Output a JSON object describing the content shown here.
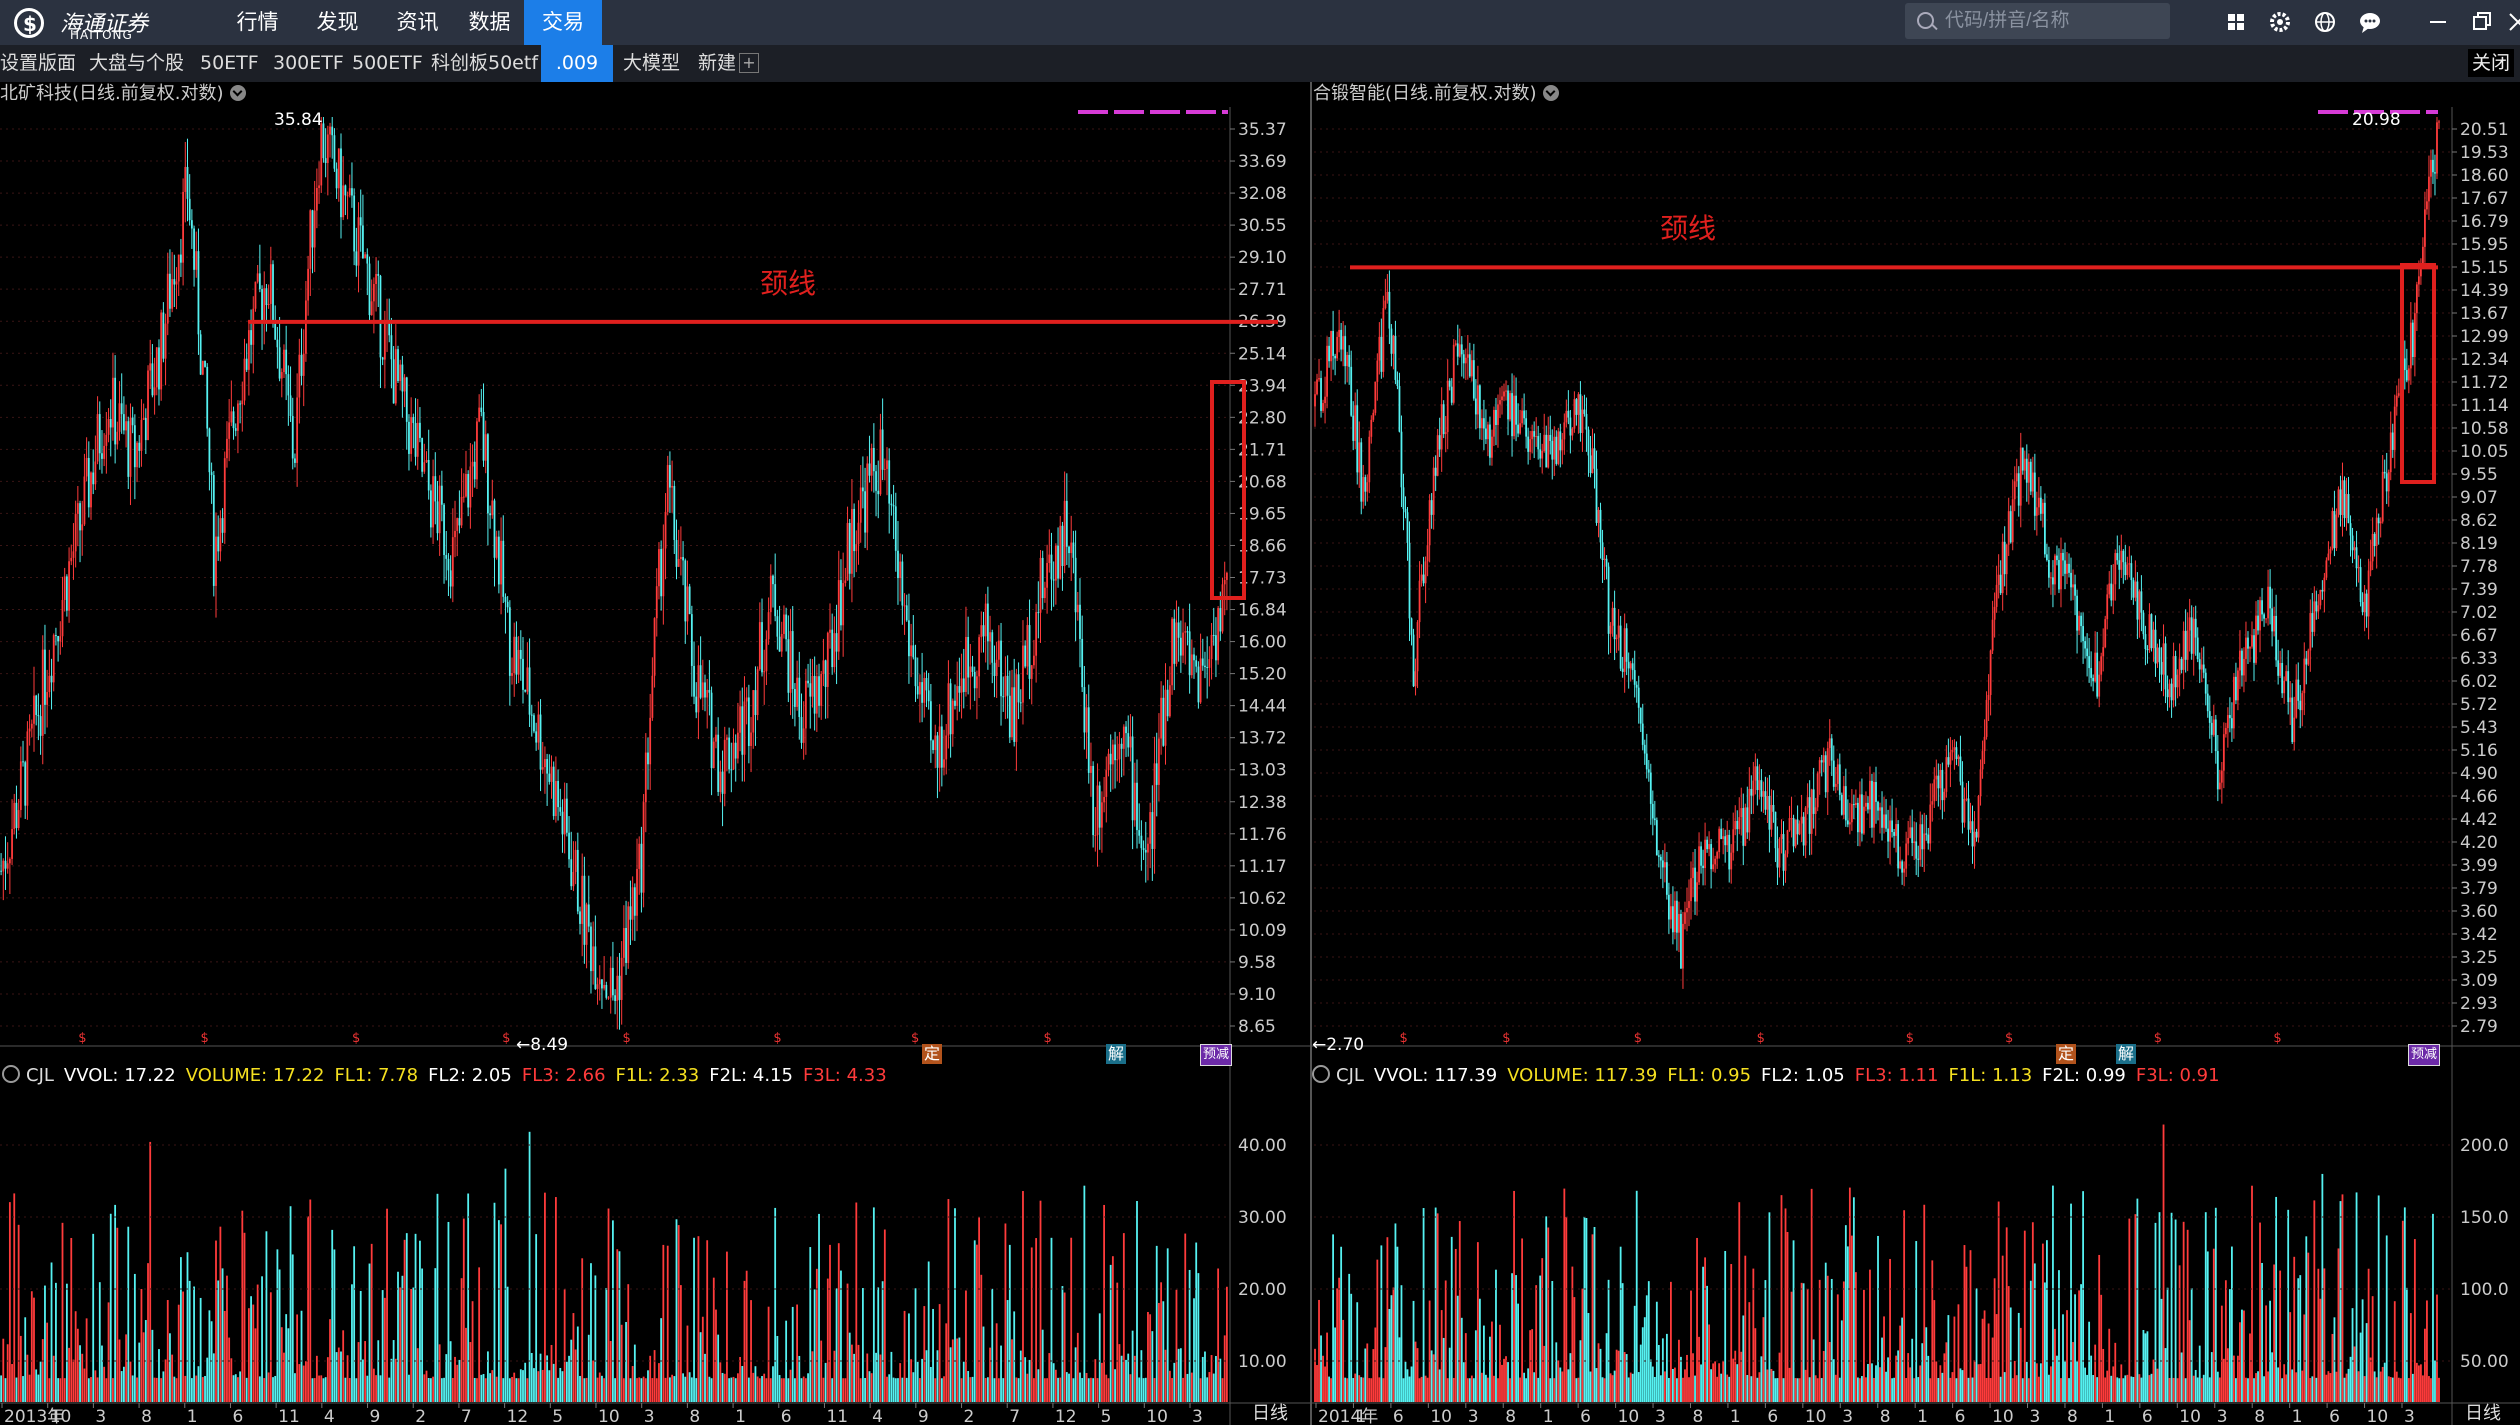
{
  "app": {
    "logo_text": "海通证券",
    "logo_sub": "HAITONG",
    "nav": [
      "行情",
      "发现",
      "资讯",
      "数据",
      "交易"
    ],
    "nav_active": 4,
    "search_placeholder": "代码/拼音/名称",
    "icons": [
      "grid-icon",
      "gear-icon",
      "globe-icon",
      "chat-icon",
      "minimize-icon",
      "restore-icon",
      "close-icon"
    ]
  },
  "toolbar": {
    "tabs": [
      "设置版面",
      "大盘与个股",
      "50ETF",
      "300ETF",
      "500ETF",
      "科创板50etf",
      ".009",
      "大模型",
      "新建"
    ],
    "active": 6,
    "close_label": "关闭"
  },
  "colors": {
    "up": "#ff3b3b",
    "down": "#55f2f2",
    "neckline": "#e0201e",
    "accent": "#1c7ee8",
    "magenta": "#d63bd6"
  },
  "panels": [
    {
      "title": "北矿科技(日线.前复权.对数)",
      "y_ticks": [
        "35.37",
        "33.69",
        "32.08",
        "30.55",
        "29.10",
        "27.71",
        "26.39",
        "25.14",
        "23.94",
        "22.80",
        "21.71",
        "20.68",
        "19.65",
        "18.66",
        "17.73",
        "16.84",
        "16.00",
        "15.20",
        "14.44",
        "13.72",
        "13.03",
        "12.38",
        "11.76",
        "11.17",
        "10.62",
        "10.09",
        "9.58",
        "9.10",
        "8.65"
      ],
      "high_label": "35.84",
      "low_label": "←8.49",
      "annotation": "颈线",
      "indicator": {
        "name": "CJL",
        "items": [
          {
            "text": "VVOL: 17.22",
            "color": "#ffffff"
          },
          {
            "text": "VOLUME: 17.22",
            "color": "#f5e020"
          },
          {
            "text": "FL1: 7.78",
            "color": "#f5e020"
          },
          {
            "text": "FL2: 2.05",
            "color": "#ffffff"
          },
          {
            "text": "FL3: 2.66",
            "color": "#ff3b3b"
          },
          {
            "text": "F1L: 2.33",
            "color": "#f5e020"
          },
          {
            "text": "F2L: 4.15",
            "color": "#ffffff"
          },
          {
            "text": "F3L: 4.33",
            "color": "#ff3b3b"
          }
        ]
      },
      "vol_ticks": [
        "40.00",
        "30.00",
        "20.00",
        "10.00"
      ],
      "x_labels": [
        "2013年",
        "10",
        "3",
        "8",
        "1",
        "6",
        "11",
        "4",
        "9",
        "2",
        "7",
        "12",
        "5",
        "10",
        "3",
        "8",
        "1",
        "6",
        "11",
        "4",
        "9",
        "2",
        "7",
        "12",
        "5",
        "10",
        "3"
      ],
      "events": [
        "定",
        "解",
        "预减"
      ],
      "chart_data": {
        "type": "candlestick",
        "scale": "log",
        "ylim": [
          8.49,
          35.84
        ],
        "neckline": 26.0,
        "notes": "approximate price path",
        "price_path": [
          11,
          13,
          16,
          19,
          23,
          21,
          25,
          32,
          18,
          24,
          28,
          21,
          35,
          31,
          27,
          23,
          20,
          18,
          22,
          16,
          14,
          12,
          10,
          9,
          11,
          20,
          15,
          13,
          14,
          17,
          14,
          15,
          19,
          21,
          16,
          13,
          15,
          16,
          14,
          17,
          19,
          12,
          14,
          11,
          16,
          15,
          17
        ]
      },
      "vol_chart": {
        "type": "bar",
        "ylim": [
          0,
          45
        ]
      }
    },
    {
      "title": "合锻智能(日线.前复权.对数)",
      "y_ticks": [
        "20.51",
        "19.53",
        "18.60",
        "17.67",
        "16.79",
        "15.95",
        "15.15",
        "14.39",
        "13.67",
        "12.99",
        "12.34",
        "11.72",
        "11.14",
        "10.58",
        "10.05",
        "9.55",
        "9.07",
        "8.62",
        "8.19",
        "7.78",
        "7.39",
        "7.02",
        "6.67",
        "6.33",
        "6.02",
        "5.72",
        "5.43",
        "5.16",
        "4.90",
        "4.66",
        "4.42",
        "4.20",
        "3.99",
        "3.79",
        "3.60",
        "3.42",
        "3.25",
        "3.09",
        "2.93",
        "2.79"
      ],
      "high_label": "20.98",
      "low_label": "←2.70",
      "annotation": "颈线",
      "indicator": {
        "name": "CJL",
        "items": [
          {
            "text": "VVOL: 117.39",
            "color": "#ffffff"
          },
          {
            "text": "VOLUME: 117.39",
            "color": "#f5e020"
          },
          {
            "text": "FL1: 0.95",
            "color": "#f5e020"
          },
          {
            "text": "FL2: 1.05",
            "color": "#ffffff"
          },
          {
            "text": "FL3: 1.11",
            "color": "#ff3b3b"
          },
          {
            "text": "F1L: 1.13",
            "color": "#f5e020"
          },
          {
            "text": "F2L: 0.99",
            "color": "#ffffff"
          },
          {
            "text": "F3L: 0.91",
            "color": "#ff3b3b"
          }
        ]
      },
      "vol_ticks": [
        "200.0",
        "150.0",
        "100.0",
        "50.00"
      ],
      "x_labels": [
        "2014年",
        "1",
        "6",
        "10",
        "3",
        "8",
        "1",
        "6",
        "10",
        "3",
        "8",
        "1",
        "6",
        "10",
        "3",
        "8",
        "1",
        "6",
        "10",
        "3",
        "8",
        "1",
        "6",
        "10",
        "3",
        "8",
        "1",
        "6",
        "10",
        "3"
      ],
      "events": [
        "定",
        "解",
        "预减"
      ],
      "chart_data": {
        "type": "candlestick",
        "scale": "log",
        "ylim": [
          2.7,
          20.98
        ],
        "neckline": 15.0,
        "notes": "approximate price path",
        "price_path": [
          11,
          13,
          9,
          14,
          6,
          10,
          13,
          10,
          11,
          10,
          10,
          11,
          7,
          6,
          4,
          3.3,
          4.2,
          4.0,
          4.7,
          4.1,
          4.3,
          5.0,
          4.4,
          4.6,
          4.1,
          4.3,
          5.1,
          4.1,
          7.5,
          9.8,
          8.0,
          7.2,
          6.0,
          8.0,
          6.7,
          6.0,
          6.8,
          4.8,
          6.3,
          7.0,
          5.4,
          7.0,
          9.0,
          7.0,
          10,
          13,
          20.5
        ]
      },
      "vol_chart": {
        "type": "bar",
        "ylim": [
          0,
          220
        ]
      }
    }
  ],
  "footer": {
    "freq": "日线"
  }
}
